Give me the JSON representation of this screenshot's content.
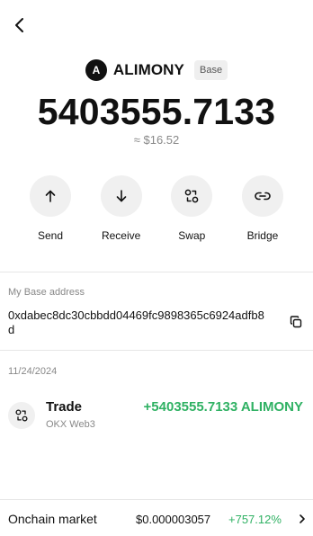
{
  "header": {
    "back_icon": "chevron-left-icon"
  },
  "token": {
    "avatar_letter": "A",
    "name": "ALIMONY",
    "network": "Base",
    "balance": "5403555.7133",
    "fiat_value": "≈ $16.52"
  },
  "actions": [
    {
      "label": "Send",
      "icon": "arrow-up-icon"
    },
    {
      "label": "Receive",
      "icon": "arrow-down-icon"
    },
    {
      "label": "Swap",
      "icon": "swap-icon"
    },
    {
      "label": "Bridge",
      "icon": "bridge-icon"
    }
  ],
  "address": {
    "label": "My Base address",
    "value": "0xdabec8dc30cbbdd04469fc9898365c6924adfb8d",
    "copy_icon": "copy-icon"
  },
  "transactions": {
    "date": "11/24/2024",
    "items": [
      {
        "type": "Trade",
        "source": "OKX Web3",
        "amount": "+5403555.7133 ALIMONY",
        "icon": "swap-icon"
      }
    ]
  },
  "market": {
    "label": "Onchain market",
    "price": "$0.000003057",
    "change": "+757.12%"
  },
  "colors": {
    "positive": "#2fb163",
    "muted": "#888888",
    "button_bg": "#f0f0f0"
  }
}
